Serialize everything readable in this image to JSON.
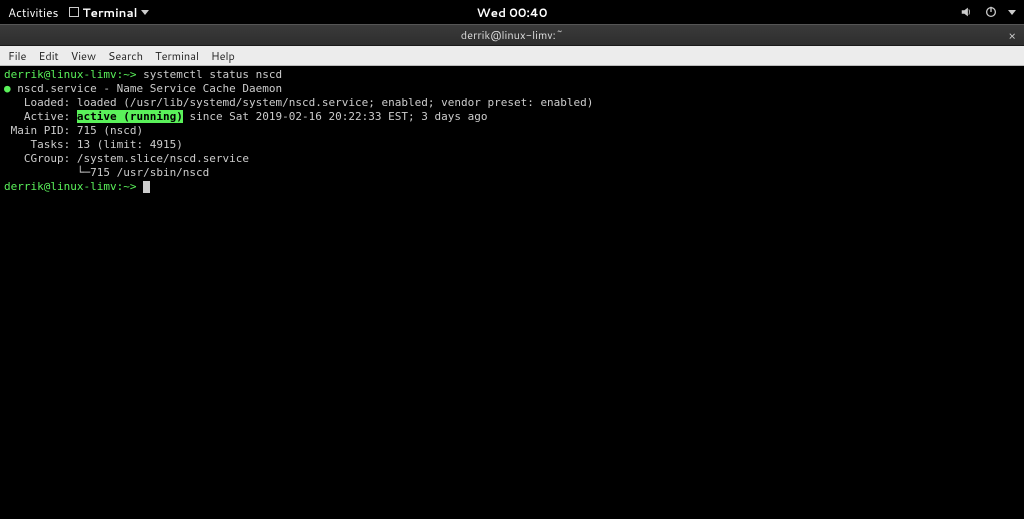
{
  "topbar": {
    "activities": "Activities",
    "app_name": "Terminal",
    "clock": "Wed 00:40"
  },
  "window": {
    "title": "derrik@linux-limv:~"
  },
  "menubar": {
    "file": "File",
    "edit": "Edit",
    "view": "View",
    "search": "Search",
    "terminal": "Terminal",
    "help": "Help"
  },
  "term": {
    "prompt1_user": "derrik@linux-limv:",
    "prompt1_path": "~>",
    "command": " systemctl status nscd",
    "bullet": "●",
    "service_line": " nscd.service - Name Service Cache Daemon",
    "loaded_label": "   Loaded: ",
    "loaded_value": "loaded (/usr/lib/systemd/system/nscd.service; enabled; vendor preset: enabled)",
    "active_label": "   Active: ",
    "active_value": "active (running)",
    "active_since": " since Sat 2019-02-16 20:22:33 EST; 3 days ago",
    "mainpid_label": " Main PID: ",
    "mainpid_value": "715 (nscd)",
    "tasks_label": "    Tasks: ",
    "tasks_value": "13 (limit: 4915)",
    "cgroup_label": "   CGroup: ",
    "cgroup_value": "/system.slice/nscd.service",
    "cgroup_child": "           └─715 /usr/sbin/nscd",
    "prompt2_user": "derrik@linux-limv:",
    "prompt2_path": "~>"
  }
}
